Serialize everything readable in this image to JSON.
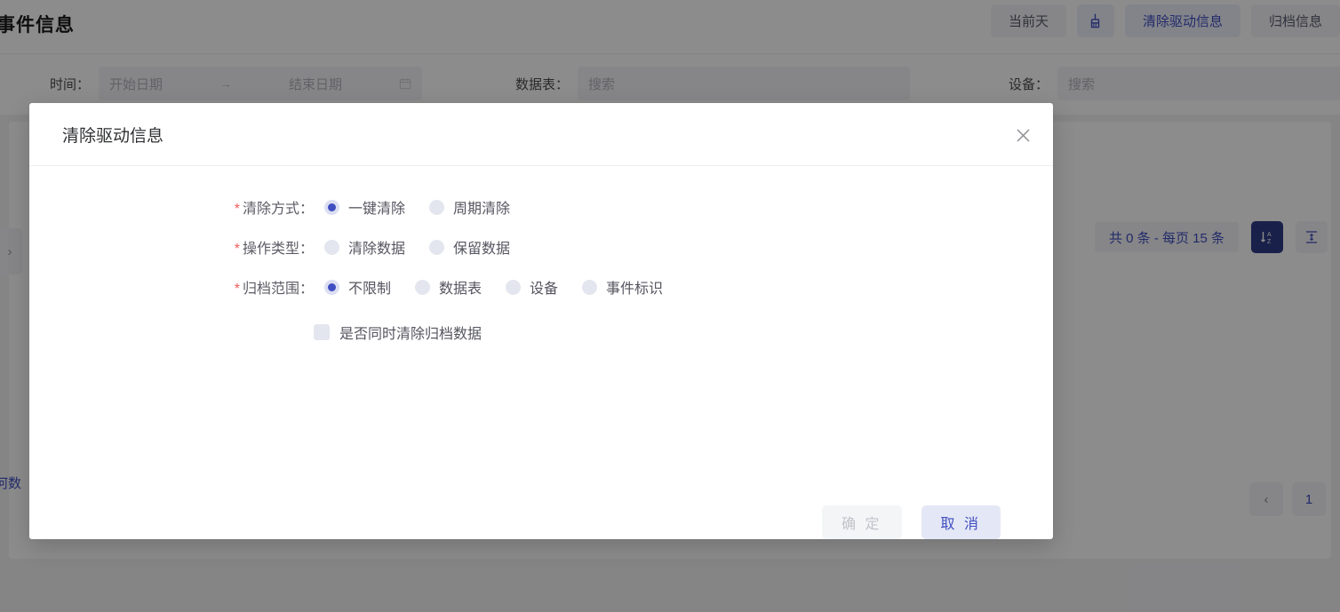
{
  "header": {
    "page_title": "事件信息",
    "actions": [
      {
        "name": "current-day-button",
        "label": "当前天",
        "style": "plain"
      },
      {
        "name": "broom-icon-button",
        "label": "",
        "style": "icon"
      },
      {
        "name": "clear-drive-info-button",
        "label": "清除驱动信息",
        "style": "blue"
      },
      {
        "name": "archive-info-button",
        "label": "归档信息",
        "style": "plain"
      }
    ]
  },
  "filters": {
    "time_label": "时间：",
    "start_date_placeholder": "开始日期",
    "range_arrow": "→",
    "end_date_placeholder": "结束日期",
    "datatable_label": "数据表：",
    "datatable_placeholder": "搜索",
    "device_label": "设备：",
    "device_placeholder": "搜索"
  },
  "board": {
    "collapse_label": "›",
    "count_text": "共 0 条 - 每页 15 条",
    "sort_icon_label": "AZ",
    "height_icon_label": "⇕",
    "empty_note": "何数",
    "pager_prev": "‹",
    "pager_page": "1"
  },
  "dialog": {
    "title": "清除驱动信息",
    "close_label": "✕",
    "rows": [
      {
        "name": "clear-mode",
        "required": "*",
        "label": "清除方式：",
        "options": [
          {
            "label": "一键清除",
            "selected": true
          },
          {
            "label": "周期清除",
            "selected": false
          }
        ]
      },
      {
        "name": "operation-type",
        "required": "*",
        "label": "操作类型：",
        "options": [
          {
            "label": "清除数据",
            "selected": false
          },
          {
            "label": "保留数据",
            "selected": false
          }
        ]
      },
      {
        "name": "archive-scope",
        "required": "*",
        "label": "归档范围：",
        "options": [
          {
            "label": "不限制",
            "selected": true
          },
          {
            "label": "数据表",
            "selected": false
          },
          {
            "label": "设备",
            "selected": false
          },
          {
            "label": "事件标识",
            "selected": false
          }
        ]
      }
    ],
    "checkbox": {
      "label": "是否同时清除归档数据",
      "checked": false
    },
    "confirm_label": "确 定",
    "cancel_label": "取 消"
  },
  "colors": {
    "accent": "#3f4ec0",
    "required_star": "#f05a5a",
    "active_tool": "#2f3b86",
    "mask": "rgba(0,0,0,0.45)"
  }
}
